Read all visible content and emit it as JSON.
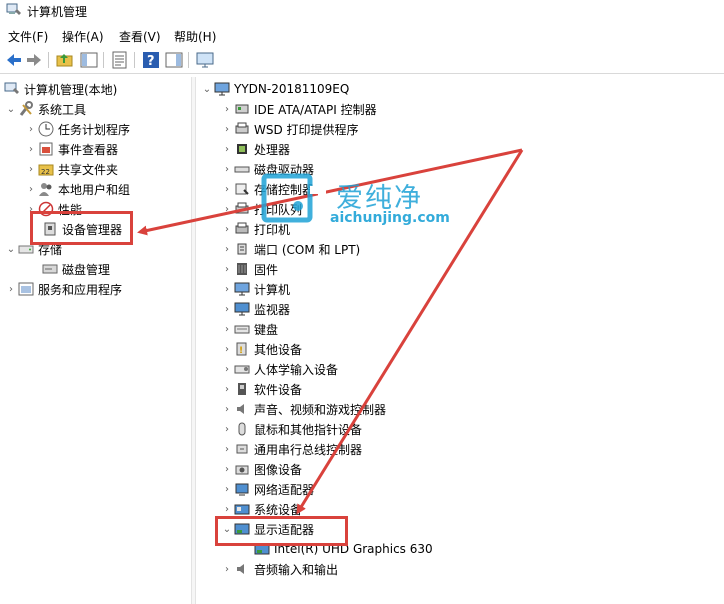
{
  "window": {
    "title": "计算机管理"
  },
  "menu": [
    "文件(F)",
    "操作(A)",
    "查看(V)",
    "帮助(H)"
  ],
  "toolbar": {
    "icons": [
      "back-icon",
      "forward-icon",
      "up-folder-icon",
      "show-hide-tree-icon",
      "properties-icon",
      "help-icon",
      "show-action-pane-icon",
      "console-icon"
    ]
  },
  "left_tree": {
    "root": "计算机管理(本地)",
    "system_tools": "系统工具",
    "items": [
      "任务计划程序",
      "事件查看器",
      "共享文件夹",
      "本地用户和组",
      "性能",
      "设备管理器"
    ],
    "storage": "存储",
    "disk_management": "磁盘管理",
    "services": "服务和应用程序"
  },
  "device_tree": {
    "root": "YYDN-20181109EQ",
    "categories": [
      "IDE ATA/ATAPI 控制器",
      "WSD 打印提供程序",
      "处理器",
      "磁盘驱动器",
      "存储控制器",
      "打印队列",
      "打印机",
      "端口 (COM 和 LPT)",
      "固件",
      "计算机",
      "监视器",
      "键盘",
      "其他设备",
      "人体学输入设备",
      "软件设备",
      "声音、视频和游戏控制器",
      "鼠标和其他指针设备",
      "通用串行总线控制器",
      "图像设备",
      "网络适配器",
      "系统设备",
      "显示适配器",
      "音频输入和输出"
    ],
    "display_child": "Intel(R) UHD Graphics 630"
  },
  "watermark": {
    "text": "爱纯净",
    "url": "aichunjing.com"
  },
  "colors": {
    "highlight": "#d9423c",
    "watermark": "#1ea2d6"
  }
}
